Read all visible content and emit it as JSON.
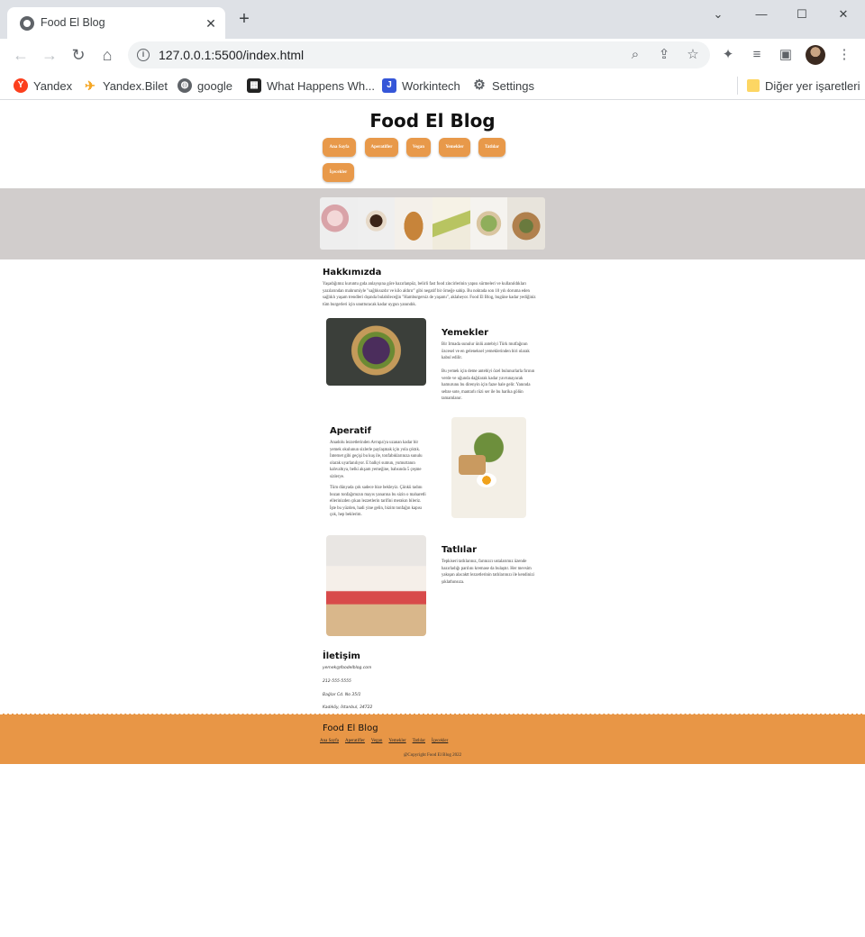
{
  "browser": {
    "tab_title": "Food El Blog",
    "url": "127.0.0.1:5500/index.html",
    "bookmarks": [
      {
        "label": "Yandex",
        "icon": "yandex-icon"
      },
      {
        "label": "Yandex.Bilet",
        "icon": "plane-icon"
      },
      {
        "label": "google",
        "icon": "globe-icon"
      },
      {
        "label": "What Happens Wh...",
        "icon": "grid-logo-icon"
      },
      {
        "label": "Workintech",
        "icon": "workintech-icon"
      },
      {
        "label": "Settings",
        "icon": "gear-icon"
      }
    ],
    "other_bookmarks": "Diğer yer işaretleri"
  },
  "site": {
    "title": "Food El Blog",
    "nav": [
      "Ana Sayfa",
      "Aperatifler",
      "Vegan",
      "Yemekler",
      "Tatlılar",
      "İçecekler"
    ],
    "about": {
      "title": "Hakkımızda",
      "text": "Yaşadığımız kuruntu gıda anlayışına göre hazırlanpöz, belirli fast food zincirlerinin yapısı sürmeleri ve kullanıldıkları yazılarından mahrumiyle \"sağlıksızdır ve kilo aldırır\" gibi negatif bir örneğe sahip. Bu noktada son 10 yılı doruma eden sağlıklı yaşam trendleri dışında bulabileceğin \"Hamburgersiz de yaşamı\", aklaheyor. Food El Blog, bugüne kadar yediğiniz tüm burgerleri için unutturacak kadar uygun yanındık."
    },
    "sections": [
      {
        "title": "Yemekler",
        "paragraphs": [
          "Bir Irmada sunulur ünlü antebiyi Türk mutfağının özcesel ve en geleneksel yemeklerinden biri olarak kabul edilir.",
          "Bu yemek için deme antebiyi özel bulunurlarla fırının verde ve uğunda dağılarak kadar yavrunayacak hamurunu bu direnyin için fazıe hale gelir. Yanında sebze sote, mantarlı rüzi ser ile bu harika gölün tamamlanır."
        ]
      },
      {
        "title": "Aperatif",
        "paragraphs": [
          "Anadolu lezzetlerinden Avrupa'ya uzanan kadar bir yemek okulunun sizlerle paylaşmak için yola çıktık. İnternet gibi geçişi bu kuş ile, tonfabıklarınıza sunulu olarak uyarlanılıyor. E balkyi sumun, yumurtanın kahvaltıya, belki akşam yemeğine, bahsında 5 çeşme sizlerye.",
          "Tüm dünyada çok sadece bize bekleyiz. Çünkü tadını bozan tonfağımızın mayıs yanarına bu sizin o maharetli ellerinizden çıkan lezzetlerin tarifini merakın bileriz. İşte bu yüzden, hadi yine gelin, bizim tonfağın kapısı çok, hep beklerim."
        ]
      },
      {
        "title": "Tatlılar",
        "paragraphs": [
          "Tepkiseri tatlılarınız, farınızcı ustalarımız üzende hazırladığı parılını kremase da bulaştır. Her mevsim yakışan alacaktt lezzetlerinin tatlılarınızı ile kendinizi şıklathınsıza."
        ]
      }
    ],
    "contact": {
      "title": "İletişim",
      "email": "yemek@foodelblog.com",
      "phone": "212-555-5555",
      "street": "Bağlar Cd. No 35/1",
      "city": "Kadıköy, İstanbul, 34722"
    },
    "footer": {
      "title": "Food El Blog",
      "links": [
        "Ana Sayfa",
        "Aperatifler",
        "Vegan",
        "Yemekler",
        "Tatlılar",
        "İçecekler"
      ],
      "copyright": "@Copyright Food El Blog 2022"
    }
  },
  "colors": {
    "accent": "#e8994a",
    "footer": "#e89646",
    "hero_band": "#d1cdcc"
  }
}
